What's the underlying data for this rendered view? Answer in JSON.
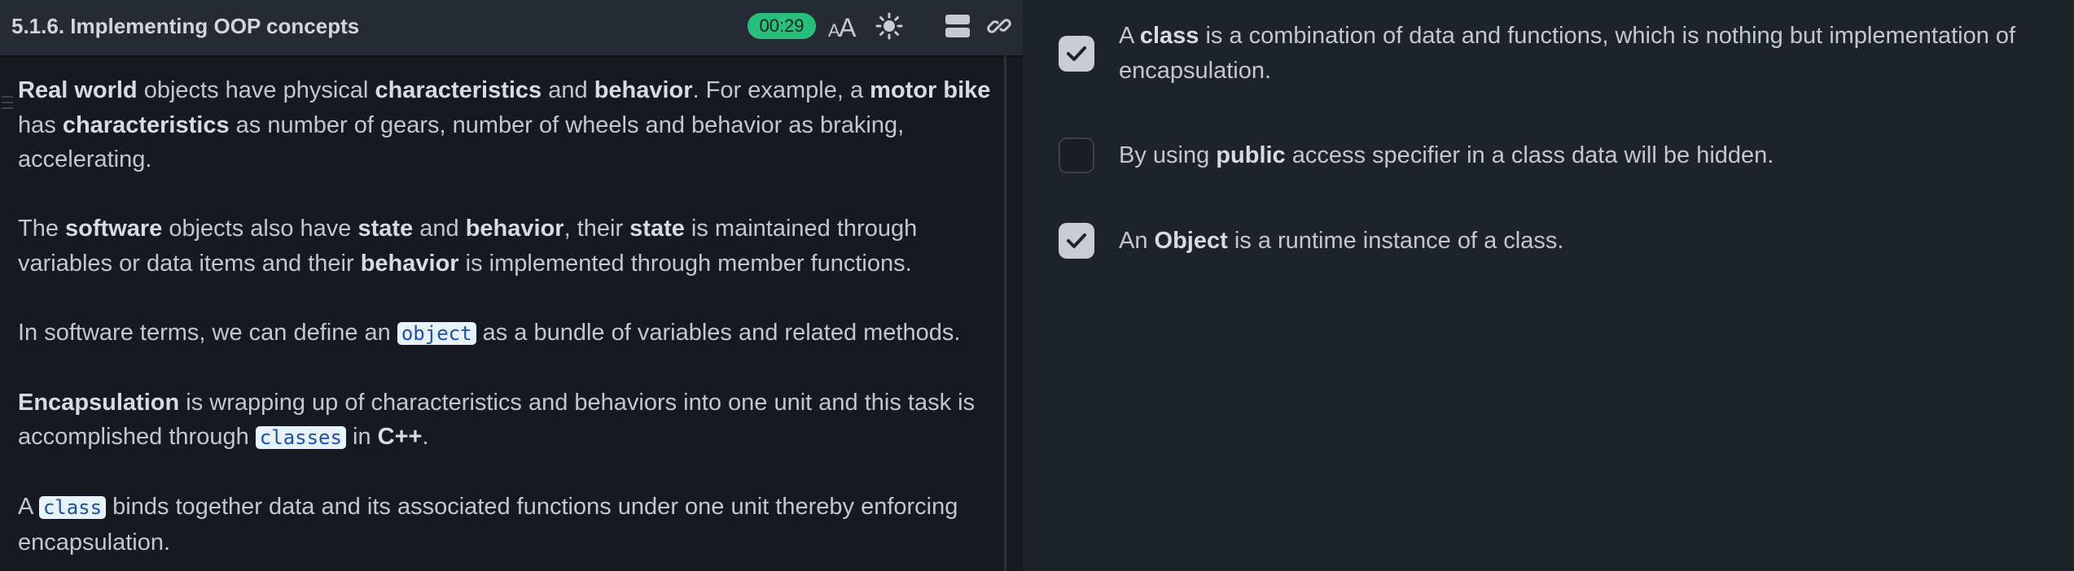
{
  "header": {
    "title": "5.1.6. Implementing OOP concepts",
    "timer": "00:29",
    "font_size_icon": "font-size-icon",
    "theme_icon": "sun-icon",
    "layout_icon": "layout-icon",
    "link_icon": "link-icon"
  },
  "content": {
    "p1": {
      "b1": "Real world",
      "t1": " objects have physical ",
      "b2": "characteristics",
      "t2": " and ",
      "b3": "behavior",
      "t3": ". For example, a ",
      "b4": "motor bike",
      "t4": " has ",
      "b5": "characteristics",
      "t5": " as number of gears, number of wheels and behavior as braking, accelerating."
    },
    "p2": {
      "t1": "The ",
      "b1": "software",
      "t2": " objects also have ",
      "b2": "state",
      "t3": " and ",
      "b3": "behavior",
      "t4": ", their ",
      "b4": "state",
      "t5": " is maintained through variables or data items and their ",
      "b5": "behavior",
      "t6": " is implemented through member functions."
    },
    "p3": {
      "t1": "In software terms, we can define an ",
      "c1": "object",
      "t2": " as a bundle of variables and related methods."
    },
    "p4": {
      "b1": "Encapsulation",
      "t1": " is wrapping up of characteristics and behaviors into one unit and this task is accomplished through ",
      "c1": "classes",
      "t2": " in ",
      "b2": "C++",
      "t3": "."
    },
    "p5": {
      "t1": "A ",
      "c1": "class",
      "t2": " binds together data and its associated functions under one unit thereby enforcing encapsulation."
    }
  },
  "options": [
    {
      "checked": true,
      "t1": "A ",
      "b1": "class",
      "t2": " is a combination of data and functions, which is nothing but implementation of encapsulation."
    },
    {
      "checked": false,
      "t1": "By using ",
      "b1": "public",
      "t2": " access specifier in a class data will be hidden."
    },
    {
      "checked": true,
      "t1": "An ",
      "b1": "Object",
      "t2": " is a runtime instance of a class."
    }
  ],
  "colors": {
    "timer_bg": "#25c07a",
    "code_bg": "#e7f4fd",
    "code_text": "#1d4fb0",
    "checkbox_checked": "#c9ccd2"
  }
}
